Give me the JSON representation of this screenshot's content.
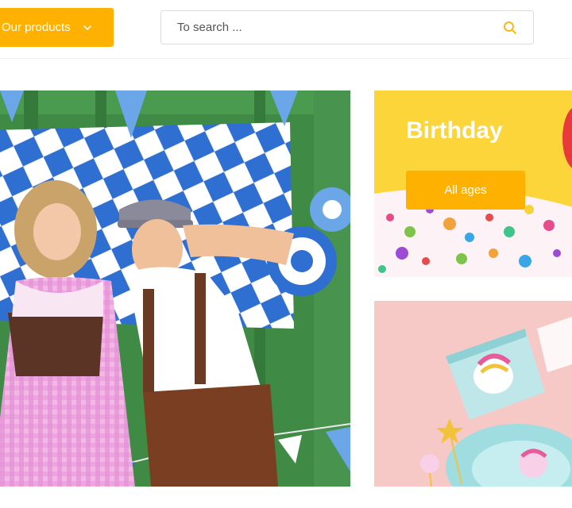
{
  "header": {
    "products_button": "Our products",
    "search_placeholder": "To search ..."
  },
  "tiles": {
    "birthday": {
      "title": "Birthday",
      "button": "All ages"
    }
  },
  "colors": {
    "accent": "#ffb100",
    "birthday_bg": "#fbd53a",
    "unicorn_bg": "#f6c9c7"
  },
  "icons": {
    "products_chevron": "chevron-down-icon",
    "search": "search-icon"
  }
}
